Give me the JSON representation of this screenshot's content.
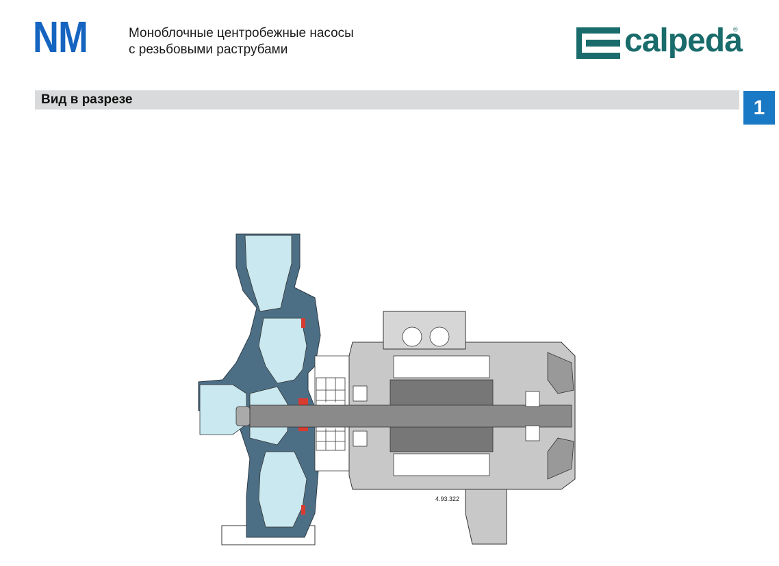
{
  "header": {
    "code": "NM",
    "title_line1": "Моноблочные центробежные насосы",
    "title_line2": "с резьбовыми раструбами"
  },
  "logo": {
    "text": "calpeda",
    "reg": "®",
    "color": "#1a6b6b"
  },
  "section": {
    "title": "Вид в разрезе",
    "page_number": "1"
  },
  "drawing": {
    "reference": "4.93.322",
    "colors": {
      "housing": "#4d6f86",
      "fluid": "#c9e8ef",
      "motor": "#c8c8c8",
      "seal": "#d93b30"
    }
  }
}
